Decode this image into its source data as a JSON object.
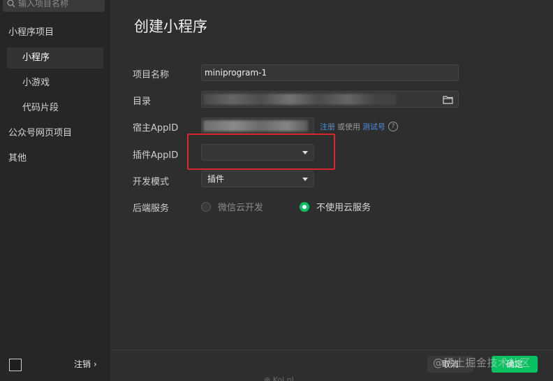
{
  "sidebar": {
    "search_placeholder": "输入项目名称",
    "items": [
      {
        "label": "小程序项目"
      },
      {
        "label": "小程序"
      },
      {
        "label": "小游戏"
      },
      {
        "label": "代码片段"
      },
      {
        "label": "公众号网页项目"
      },
      {
        "label": "其他"
      }
    ],
    "logout_label": "注销",
    "logout_chevron": "›"
  },
  "main": {
    "title": "创建小程序",
    "fields": {
      "name_label": "项目名称",
      "name_value": "miniprogram-1",
      "dir_label": "目录",
      "host_appid_label": "宿主AppID",
      "plugin_appid_label": "插件AppID",
      "plugin_appid_value": "",
      "dev_mode_label": "开发模式",
      "dev_mode_value": "插件",
      "backend_label": "后端服务",
      "backend_options": [
        {
          "label": "微信云开发",
          "selected": false
        },
        {
          "label": "不使用云服务",
          "selected": true
        }
      ]
    },
    "links": {
      "register": "注册",
      "or_use": "或使用",
      "test_account": "测试号",
      "help": "?"
    }
  },
  "footer": {
    "cancel_label": "取消",
    "ok_label": "确定",
    "watermark": "@稀土掘金技术社区",
    "bottom_peek": "⊕ Kol.nl"
  },
  "colors": {
    "accent_green": "#07c160",
    "link_blue": "#4a90e2",
    "highlight_red": "#d9272c",
    "background": "#2e2e2e",
    "sidebar_bg": "#262626"
  }
}
